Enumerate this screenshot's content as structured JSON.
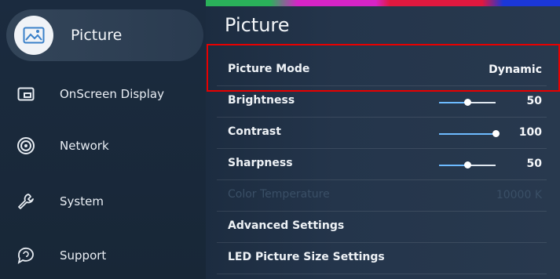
{
  "sidebar": {
    "active_label": "Picture",
    "items": [
      {
        "label": "OnScreen Display",
        "icon": "onscreen-display-icon"
      },
      {
        "label": "Network",
        "icon": "network-icon"
      },
      {
        "label": "System",
        "icon": "wrench-icon"
      },
      {
        "label": "Support",
        "icon": "support-icon"
      }
    ],
    "active_icon": "picture-icon"
  },
  "panel": {
    "title": "Picture",
    "rows": [
      {
        "label": "Picture Mode",
        "value": "Dynamic"
      },
      {
        "label": "Brightness",
        "value": "50",
        "level": 50
      },
      {
        "label": "Contrast",
        "value": "100",
        "level": 100
      },
      {
        "label": "Sharpness",
        "value": "50",
        "level": 50
      },
      {
        "label": "Color Temperature",
        "value": "10000 K",
        "disabled": true
      },
      {
        "label": "Advanced Settings"
      },
      {
        "label": "LED Picture Size Settings"
      }
    ]
  },
  "colors": {
    "highlight_box": "#e80000",
    "slider_fill": "#6dbbff"
  }
}
